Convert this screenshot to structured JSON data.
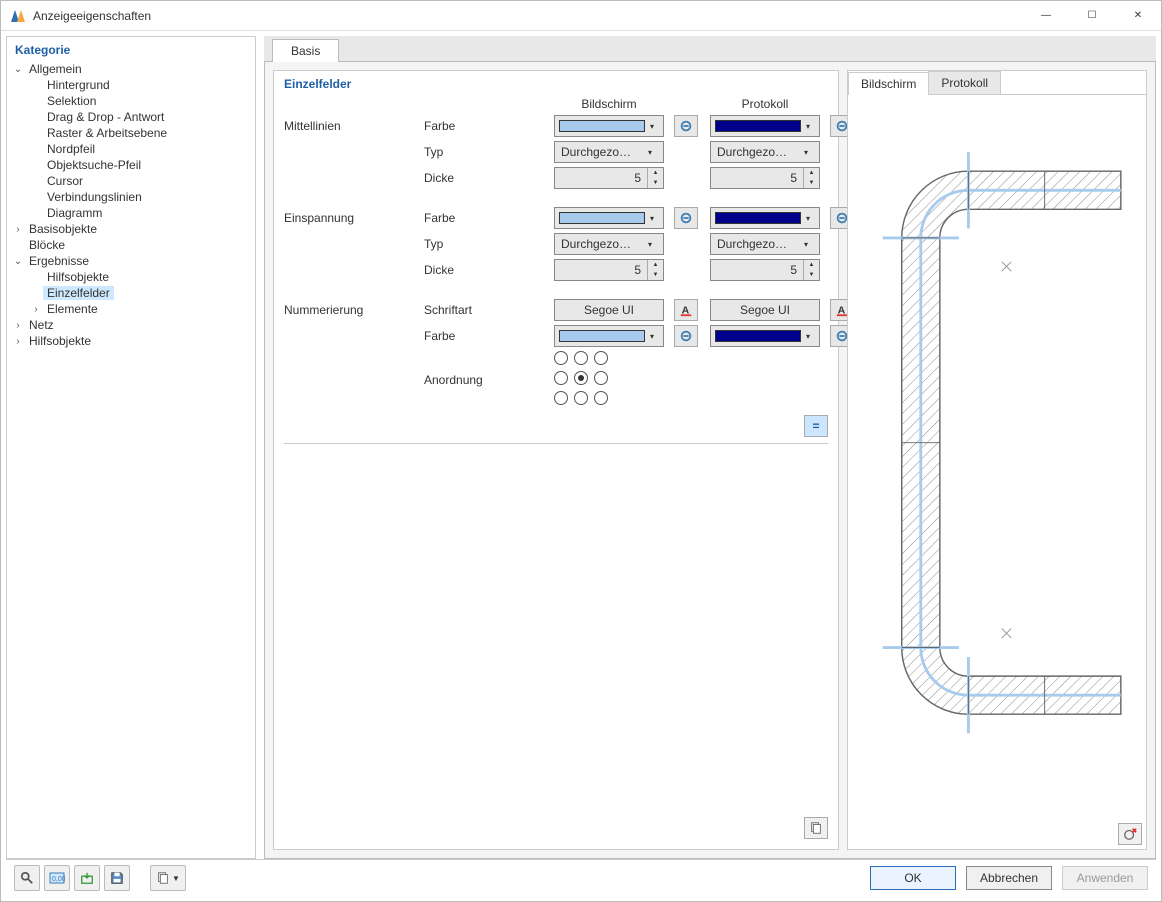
{
  "window": {
    "title": "Anzeigeeigenschaften",
    "minimize": "—",
    "maximize": "☐",
    "close": "✕"
  },
  "tree": {
    "title": "Kategorie",
    "items": [
      {
        "label": "Allgemein",
        "level": 0,
        "caret": "⌄",
        "expanded": true
      },
      {
        "label": "Hintergrund",
        "level": 1
      },
      {
        "label": "Selektion",
        "level": 1
      },
      {
        "label": "Drag & Drop - Antwort",
        "level": 1
      },
      {
        "label": "Raster & Arbeitsebene",
        "level": 1
      },
      {
        "label": "Nordpfeil",
        "level": 1
      },
      {
        "label": "Objektsuche-Pfeil",
        "level": 1
      },
      {
        "label": "Cursor",
        "level": 1
      },
      {
        "label": "Verbindungslinien",
        "level": 1
      },
      {
        "label": "Diagramm",
        "level": 1
      },
      {
        "label": "Basisobjekte",
        "level": 0,
        "caret": "›"
      },
      {
        "label": "Blöcke",
        "level": 0
      },
      {
        "label": "Ergebnisse",
        "level": 0,
        "caret": "⌄",
        "expanded": true
      },
      {
        "label": "Hilfsobjekte",
        "level": 1
      },
      {
        "label": "Einzelfelder",
        "level": 1,
        "selected": true
      },
      {
        "label": "Elemente",
        "level": 1,
        "caret": "›"
      },
      {
        "label": "Netz",
        "level": 0,
        "caret": "›"
      },
      {
        "label": "Hilfsobjekte",
        "level": 0,
        "caret": "›"
      }
    ]
  },
  "tabs": {
    "basis": "Basis"
  },
  "section": {
    "title": "Einzelfelder",
    "headers": {
      "screen": "Bildschirm",
      "protocol": "Protokoll"
    }
  },
  "groups": {
    "mittellinien": {
      "label": "Mittellinien",
      "farbe": "Farbe",
      "typ": "Typ",
      "dicke": "Dicke",
      "typ_val": "Durchgezo…",
      "dicke_val": "5"
    },
    "einspannung": {
      "label": "Einspannung",
      "farbe": "Farbe",
      "typ": "Typ",
      "dicke": "Dicke",
      "typ_val": "Durchgezo…",
      "dicke_val": "5"
    },
    "nummerierung": {
      "label": "Nummerierung",
      "schriftart": "Schriftart",
      "farbe": "Farbe",
      "anordnung": "Anordnung",
      "font_val": "Segoe UI"
    }
  },
  "colors": {
    "screen_swatch": "#a7cbed",
    "protocol_swatch": "#00008b"
  },
  "preview": {
    "tabs": {
      "screen": "Bildschirm",
      "protocol": "Protokoll"
    }
  },
  "buttons": {
    "ok": "OK",
    "cancel": "Abbrechen",
    "apply": "Anwenden"
  },
  "eq_symbol": "=",
  "caret_down": "▾"
}
